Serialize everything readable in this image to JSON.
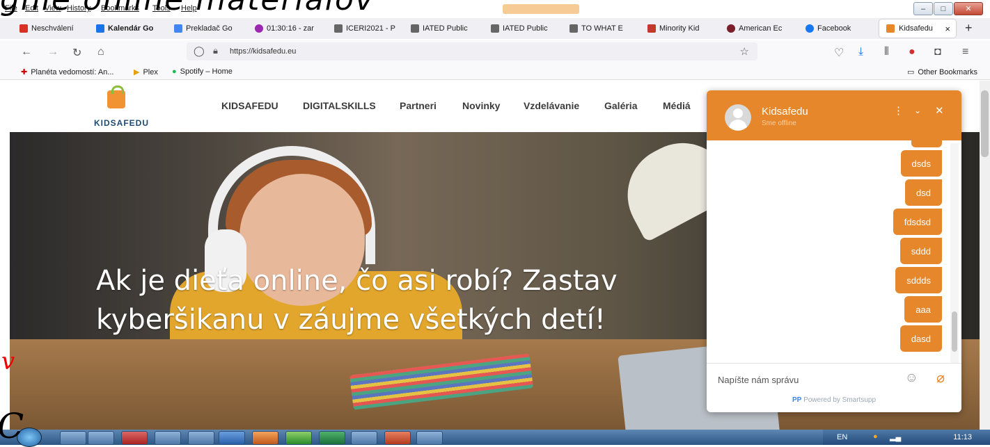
{
  "overlay": {
    "scribble": "gnie online materiálov",
    "red_mark": "v",
    "black_mark": "C"
  },
  "menubar": {
    "items": [
      "File",
      "Edit",
      "View",
      "History",
      "Bookmarks",
      "Tools",
      "Help"
    ]
  },
  "tabs": [
    {
      "label": "Neschválení",
      "icon": "gmail-icon",
      "color": "#d93025"
    },
    {
      "label": "Kalendár Go",
      "icon": "calendar-icon",
      "color": "#1a73e8"
    },
    {
      "label": "Prekladač Go",
      "icon": "translate-icon",
      "color": "#4285f4"
    },
    {
      "label": "01:30:16 - zar",
      "icon": "timer-icon",
      "color": "#9c27b0"
    },
    {
      "label": "ICERI2021 - P",
      "icon": "iated-icon",
      "color": "#666666"
    },
    {
      "label": "IATED Public",
      "icon": "iated-icon",
      "color": "#666666"
    },
    {
      "label": "IATED Public",
      "icon": "iated-icon",
      "color": "#666666"
    },
    {
      "label": "TO WHAT E",
      "icon": "iated-icon",
      "color": "#666666"
    },
    {
      "label": "Minority Kid",
      "icon": "doc-icon",
      "color": "#c0392b"
    },
    {
      "label": "American Ec",
      "icon": "globe-icon",
      "color": "#7b1f2a"
    },
    {
      "label": "Facebook",
      "icon": "facebook-icon",
      "color": "#1877f2"
    }
  ],
  "active_tab": {
    "label": "Kidsafedu",
    "close": "×"
  },
  "newtab_label": "+",
  "address": {
    "url": "https://kidsafedu.eu"
  },
  "bookmarks": [
    {
      "label": "Planéta vedomostí: An...",
      "icon": "flag-icon"
    },
    {
      "label": "Plex",
      "icon": "plex-icon"
    },
    {
      "label": "Spotify – Home",
      "icon": "spotify-icon"
    }
  ],
  "other_bookmarks": "Other Bookmarks",
  "site": {
    "logo_text": "KIDSAFEDU",
    "nav": [
      "KIDSAFEDU",
      "DIGITALSKILLS",
      "Partneri",
      "Novinky",
      "Vzdelávanie",
      "Galéria",
      "Médiá"
    ],
    "hero_line1": "Ak je dieťa online, čo asi robí? Zastav",
    "hero_line2": "kyberšikanu v záujme všetkých detí!"
  },
  "chat": {
    "name": "Kidsafedu",
    "status": "Sme offline",
    "messages": [
      "dsds",
      "dsd",
      "fdsdsd",
      "sddd",
      "sddds",
      "aaa",
      "dasd"
    ],
    "input_placeholder": "Napíšte nám správu",
    "powered": "Powered by Smartsupp"
  },
  "taskbar": {
    "lang": "EN",
    "time": "11:13"
  },
  "colors": {
    "accent": "#e6872b",
    "logo_green": "#8dbd3c",
    "logo_blue": "#1e4a72"
  }
}
